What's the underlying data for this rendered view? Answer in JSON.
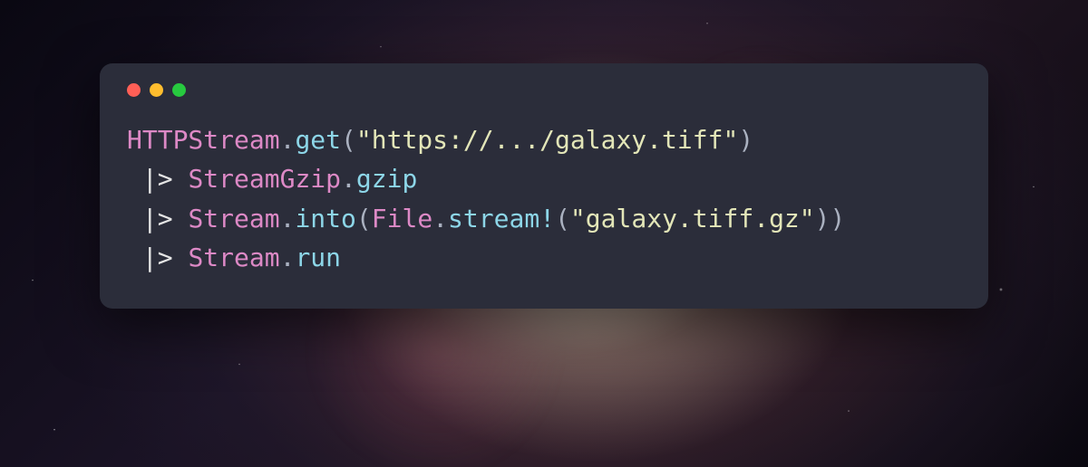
{
  "code": {
    "line1": {
      "module1": "HTTPStream",
      "dot": ".",
      "method": "get",
      "lparen": "(",
      "string": "\"https://.../galaxy.tiff\"",
      "rparen": ")"
    },
    "line2": {
      "pipe": " |> ",
      "module1": "StreamGzip",
      "dot": ".",
      "method": "gzip"
    },
    "line3": {
      "pipe": " |> ",
      "module1": "Stream",
      "dot1": ".",
      "method1": "into",
      "lparen1": "(",
      "module2": "File",
      "dot2": ".",
      "method2": "stream",
      "bang": "!",
      "lparen2": "(",
      "string": "\"galaxy.tiff.gz\"",
      "rparen2": ")",
      "rparen1": ")"
    },
    "line4": {
      "pipe": " |> ",
      "module1": "Stream",
      "dot": ".",
      "method": "run"
    }
  }
}
